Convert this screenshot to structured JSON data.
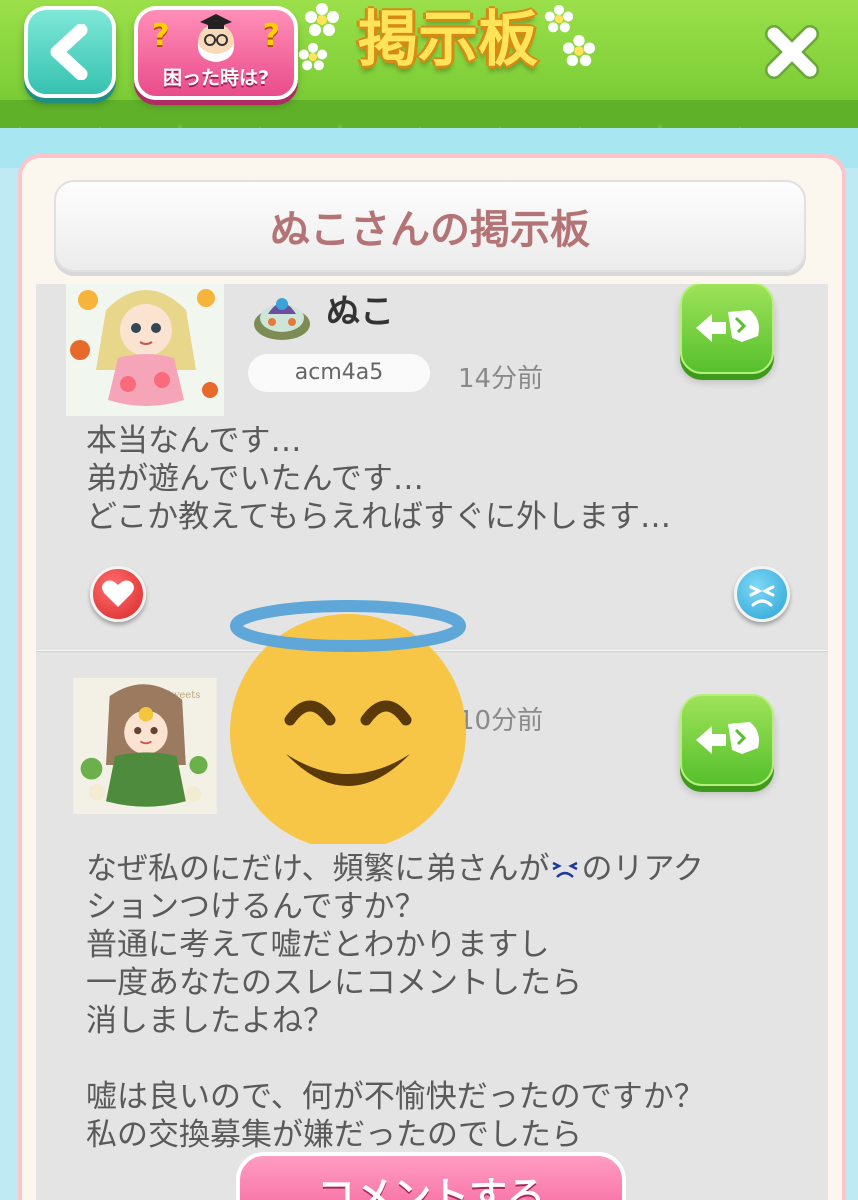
{
  "header": {
    "help_label": "困った時は?",
    "board_title": "掲示板"
  },
  "panel": {
    "title": "ぬこさんの掲示板"
  },
  "posts": [
    {
      "username": "ぬこ",
      "user_id": "acm4a5",
      "time": "14分前",
      "body": "本当なんです…\n弟が遊んでいたんです…\nどこか教えてもらえればすぐに外します…"
    },
    {
      "time": "10分前",
      "body_pre": "なぜ私のにだけ、頻繁に弟さんが",
      "body_post": "のリアク",
      "body_rest": "ションつけるんですか？\n普通に考えて嘘だとわかりますし\n一度あなたのスレにコメントしたら\n消しましたよね？\n\n嘘は良いので、何が不愉快だったのですか？\n私の交換募集が嫌だったのでしたら",
      "avatar_text": "Sweets"
    }
  ],
  "comment_button": "コメントする",
  "colors": {
    "panel_title": "#b47476",
    "comment_button": "#f1518f",
    "share_button": "#57c02c"
  }
}
